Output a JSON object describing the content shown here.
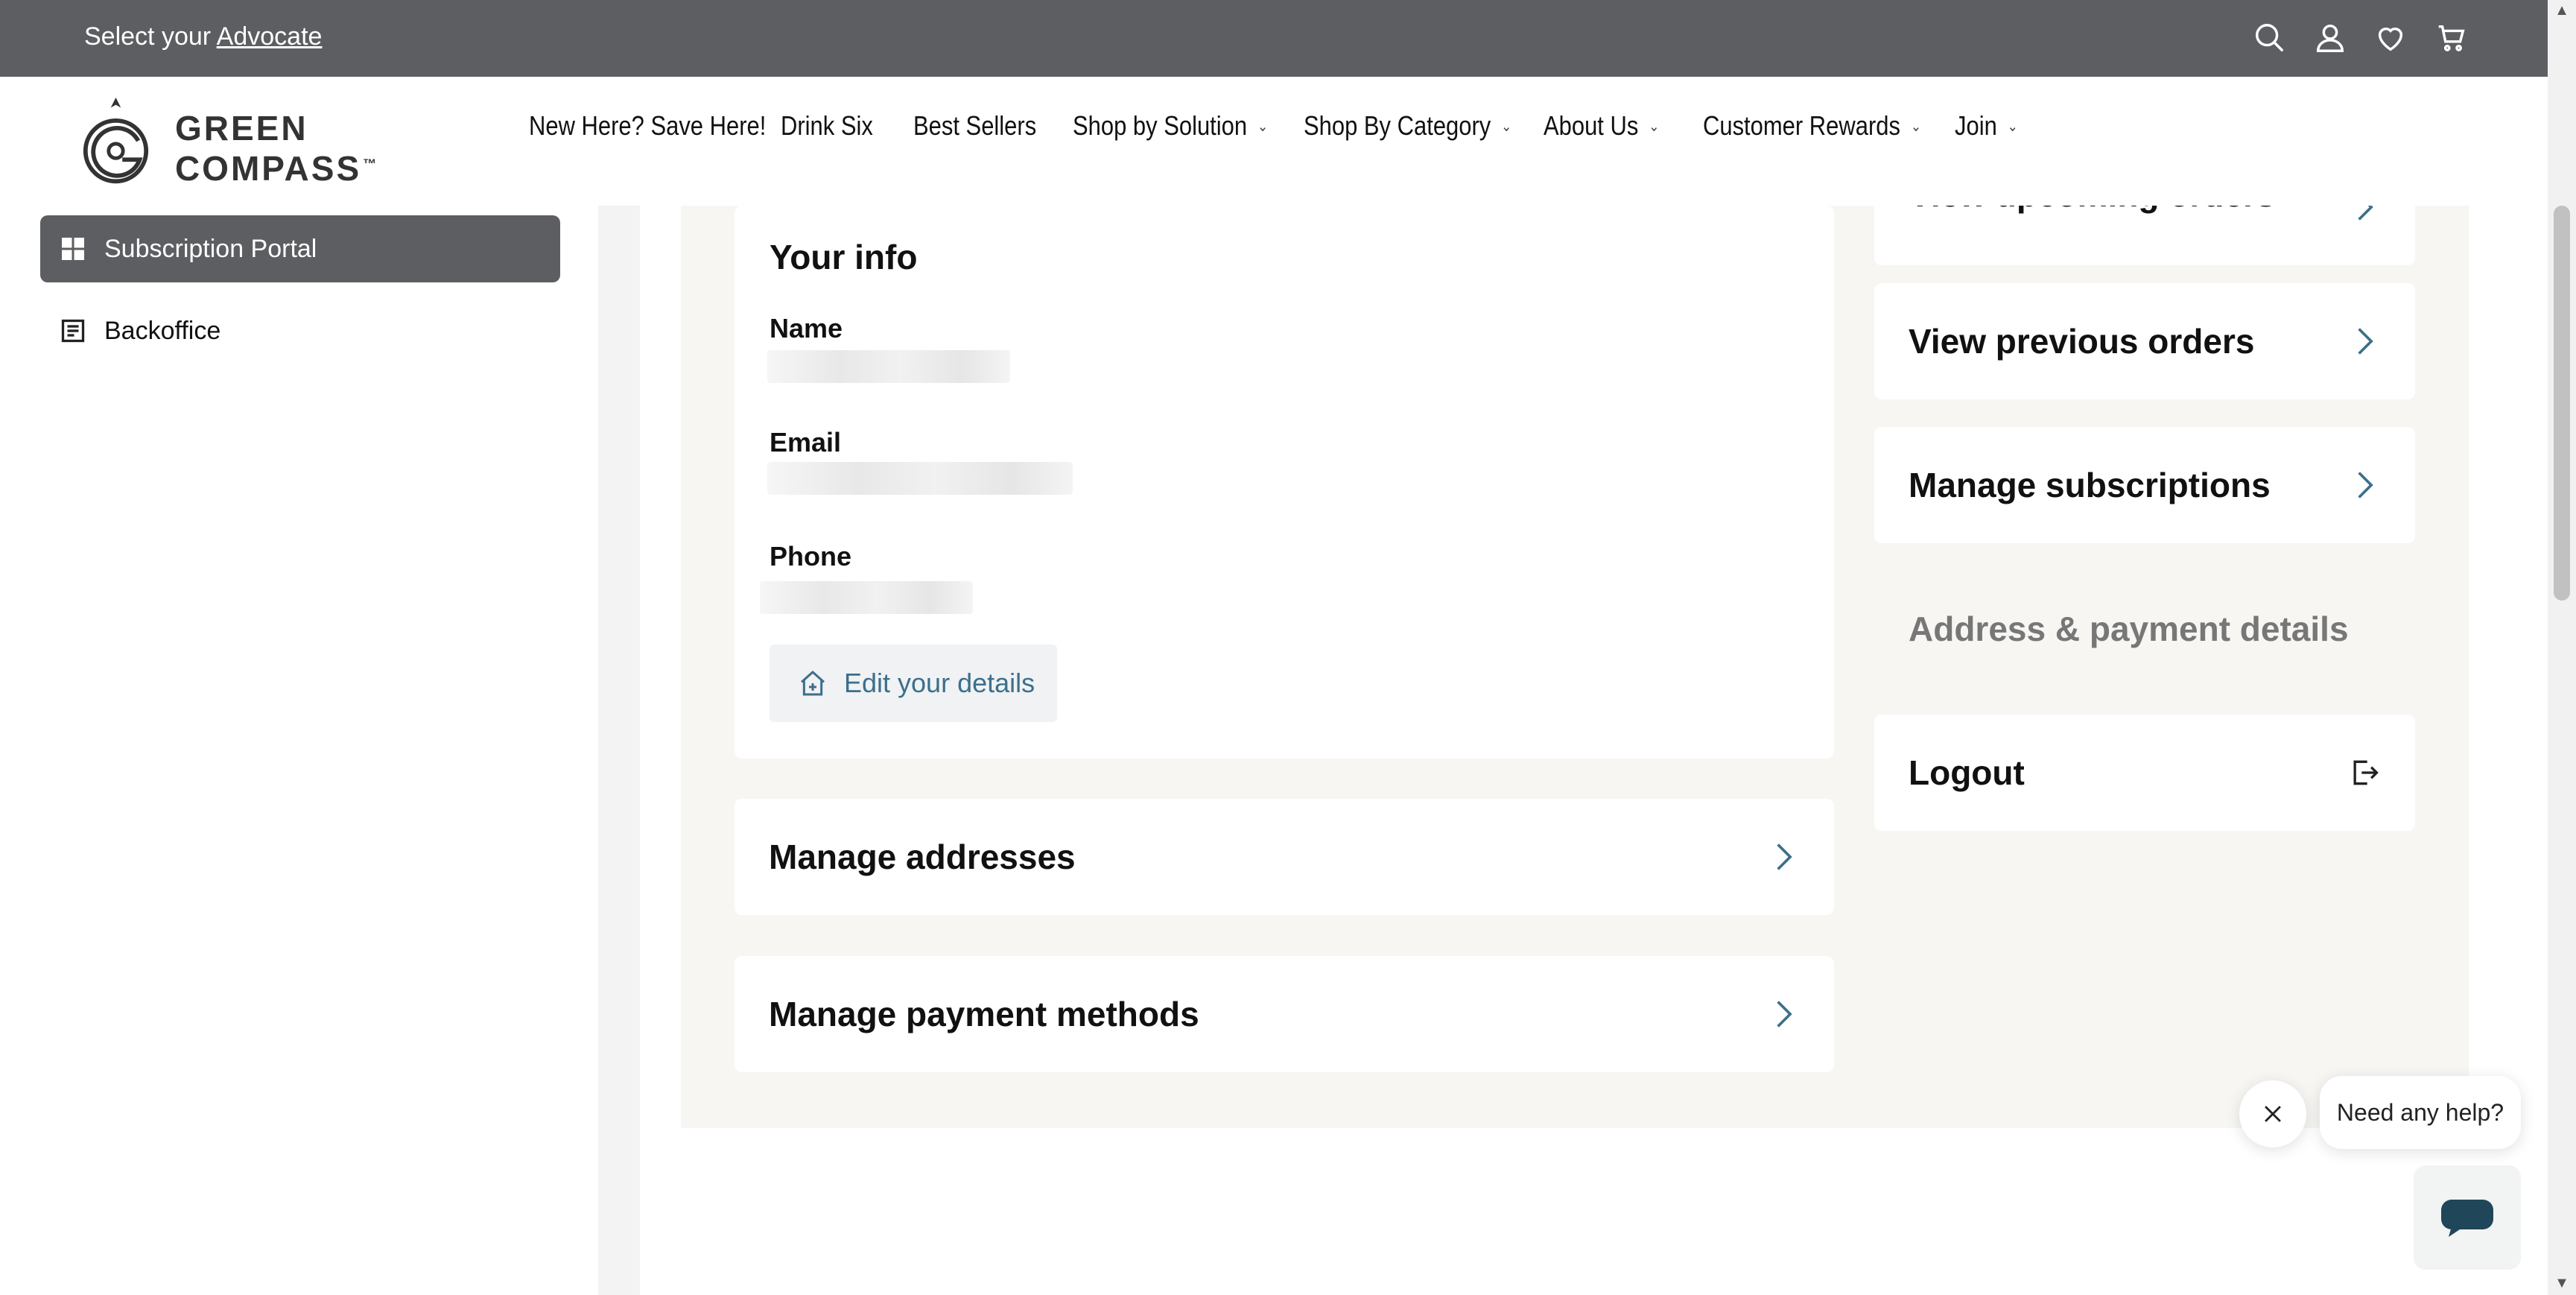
{
  "topbar": {
    "advocate_prefix": "Select your",
    "advocate_link": "Advocate"
  },
  "icons": {
    "search": "search-icon",
    "account": "user-icon",
    "wishlist": "heart-icon",
    "cart": "cart-icon"
  },
  "brand": {
    "name": "GREEN COMPASS",
    "trademark": "™"
  },
  "nav": {
    "items": [
      {
        "label": "New Here? Save Here!",
        "dropdown": false
      },
      {
        "label": "Drink Six",
        "dropdown": false
      },
      {
        "label": "Best Sellers",
        "dropdown": false
      },
      {
        "label": "Shop by Solution",
        "dropdown": true
      },
      {
        "label": "Shop By Category",
        "dropdown": true
      },
      {
        "label": "About Us",
        "dropdown": true
      },
      {
        "label": "Customer Rewards",
        "dropdown": true
      },
      {
        "label": "Join",
        "dropdown": true
      }
    ]
  },
  "sidebar": {
    "items": [
      {
        "label": "Subscription Portal",
        "active": true,
        "icon": "grid-icon"
      },
      {
        "label": "Backoffice",
        "active": false,
        "icon": "document-icon"
      }
    ]
  },
  "info": {
    "title": "Your info",
    "name_label": "Name",
    "email_label": "Email",
    "phone_label": "Phone",
    "edit_label": "Edit your details"
  },
  "main_links": {
    "addresses": "Manage addresses",
    "payments": "Manage payment methods"
  },
  "right_links": {
    "upcoming": "View upcoming orders",
    "previous": "View previous orders",
    "subscriptions": "Manage subscriptions",
    "address_payment": "Address & payment details",
    "logout": "Logout"
  },
  "chat": {
    "prompt": "Need any help?"
  },
  "colors": {
    "topbar_bg": "#5c5e62",
    "active_sidebar_bg": "#5c5e62",
    "panel_bg": "#f7f6f3",
    "link_accent": "#3c6f8a"
  }
}
